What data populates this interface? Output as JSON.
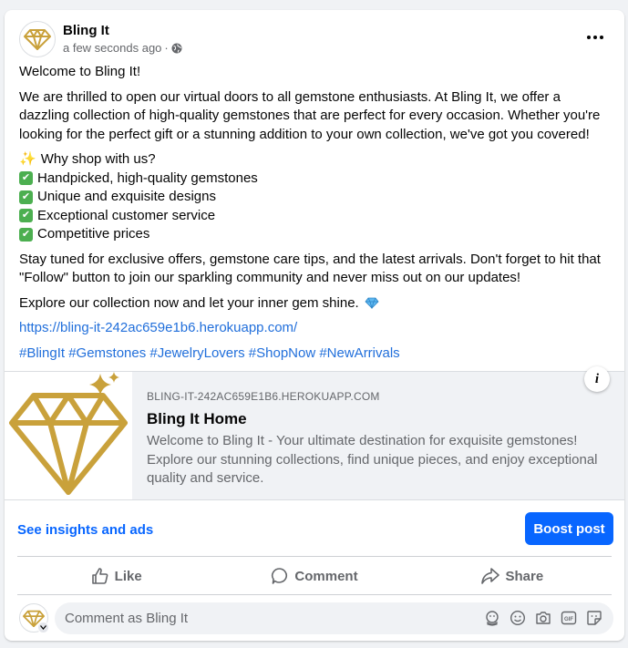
{
  "post": {
    "page_name": "Bling It",
    "timestamp": "a few seconds ago",
    "separator": "·"
  },
  "body": {
    "greeting": "Welcome to Bling It!",
    "intro": "We are thrilled to open our virtual doors to all gemstone enthusiasts. At Bling It, we offer a dazzling collection of high-quality gemstones that are perfect for every occasion. Whether you're looking for the perfect gift or a stunning addition to your own collection, we've got you covered!",
    "why_heading": "Why shop with us?",
    "sparkle_emoji": "✨",
    "check_emoji": "✔",
    "bullets": [
      "Handpicked, high-quality gemstones",
      "Unique and exquisite designs",
      "Exceptional customer service",
      "Competitive prices"
    ],
    "stay_tuned": "Stay tuned for exclusive offers, gemstone care tips, and the latest arrivals. Don't forget to hit that \"Follow\" button to join our sparkling community and never miss out on our updates!",
    "explore": "Explore our collection now and let your inner gem shine.",
    "link": "https://bling-it-242ac659e1b6.herokuapp.com/",
    "hashtags": "#BlingIt #Gemstones #JewelryLovers #ShopNow #NewArrivals"
  },
  "preview": {
    "domain": "BLING-IT-242AC659E1B6.HEROKUAPP.COM",
    "title": "Bling It Home",
    "description": "Welcome to Bling It - Your ultimate destination for exquisite gemstones! Explore our stunning collections, find unique pieces, and enjoy exceptional quality and service.",
    "info_label": "i"
  },
  "footer": {
    "insights_label": "See insights and ads",
    "boost_label": "Boost post"
  },
  "actions": {
    "like": "Like",
    "comment": "Comment",
    "share": "Share"
  },
  "composer": {
    "placeholder": "Comment as Bling It"
  },
  "icons": {
    "avatar": "gold-diamond-logo",
    "audience": "globe-icon",
    "more": "more-horizontal-icon",
    "like": "thumbs-up-icon",
    "comment": "speech-bubble-icon",
    "share": "share-arrow-icon",
    "composer_icons": [
      "avatar-sticker-icon",
      "emoji-icon",
      "camera-icon",
      "gif-icon",
      "sticker-icon"
    ]
  },
  "colors": {
    "brand_blue": "#0866ff",
    "link_blue": "#216fdb",
    "gold": "#c9a13b",
    "check_green": "#4caf50",
    "muted_text": "#65676b"
  }
}
